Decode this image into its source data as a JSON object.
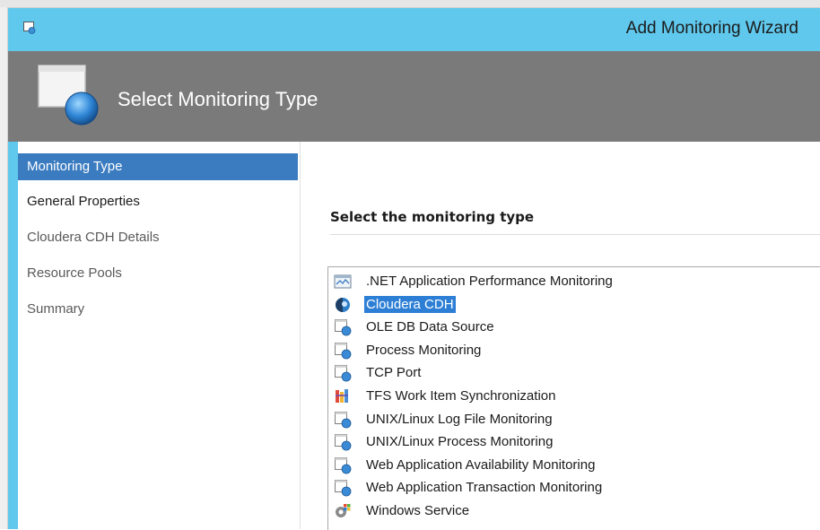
{
  "window": {
    "title": "Add Monitoring Wizard",
    "icon": "wizard-window-icon"
  },
  "header": {
    "title": "Select Monitoring Type",
    "icon": "monitor-large-icon"
  },
  "nav": {
    "items": [
      {
        "label": "Monitoring Type",
        "state": "active"
      },
      {
        "label": "General Properties",
        "state": "enabled"
      },
      {
        "label": "Cloudera CDH Details",
        "state": "disabled"
      },
      {
        "label": "Resource Pools",
        "state": "disabled"
      },
      {
        "label": "Summary",
        "state": "disabled"
      }
    ]
  },
  "content": {
    "heading": "Select the monitoring type",
    "types": [
      {
        "label": ".NET Application Performance Monitoring",
        "icon": "net-app-monitor-icon",
        "selected": false
      },
      {
        "label": "Cloudera CDH",
        "icon": "cloudera-icon",
        "selected": true
      },
      {
        "label": "OLE DB Data Source",
        "icon": "monitor-small-icon",
        "selected": false
      },
      {
        "label": "Process Monitoring",
        "icon": "monitor-small-icon",
        "selected": false
      },
      {
        "label": "TCP Port",
        "icon": "monitor-small-icon",
        "selected": false
      },
      {
        "label": "TFS Work Item Synchronization",
        "icon": "tfs-icon",
        "selected": false
      },
      {
        "label": "UNIX/Linux Log File Monitoring",
        "icon": "monitor-small-icon",
        "selected": false
      },
      {
        "label": "UNIX/Linux Process Monitoring",
        "icon": "monitor-small-icon",
        "selected": false
      },
      {
        "label": "Web Application Availability Monitoring",
        "icon": "monitor-small-icon",
        "selected": false
      },
      {
        "label": "Web Application Transaction Monitoring",
        "icon": "monitor-small-icon",
        "selected": false
      },
      {
        "label": "Windows Service",
        "icon": "windows-service-icon",
        "selected": false
      }
    ]
  },
  "colors": {
    "titlebar": "#5fc8ec",
    "header": "#7a7a7a",
    "active_nav": "#3b7cc0",
    "selection": "#2d7fd5"
  }
}
